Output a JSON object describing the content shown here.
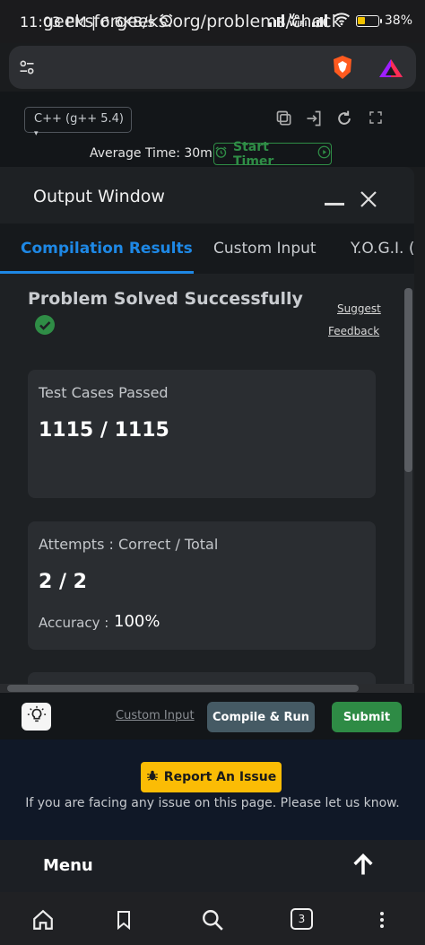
{
  "status_bar": {
    "time_speed": "11:03 PM | 6.6KB/s",
    "wifi_label": "Vo\nWiFi",
    "battery": "38%",
    "battery_level": 0.38
  },
  "browser": {
    "url": "geeksforgeeks.org/problems/check"
  },
  "editor": {
    "language": "C++ (g++ 5.4)",
    "average_time": "Average Time: 30m",
    "start_timer": "Start Timer"
  },
  "output_window": {
    "title": "Output Window",
    "tabs": [
      {
        "label": "Compilation Results",
        "active": true
      },
      {
        "label": "Custom Input",
        "active": false
      },
      {
        "label": "Y.O.G.I. (A",
        "active": false
      }
    ],
    "result_title": "Problem Solved Successfully",
    "suggest_link": "Suggest",
    "feedback_link": "Feedback",
    "test_cases": {
      "label": "Test Cases Passed",
      "value": "1115 / 1115"
    },
    "attempts": {
      "label": "Attempts : Correct / Total",
      "value": "2 / 2",
      "accuracy_label": "Accuracy :",
      "accuracy_value": "100%"
    }
  },
  "actions": {
    "custom_input": "Custom Input",
    "compile_run": "Compile & Run",
    "submit": "Submit"
  },
  "footer": {
    "report_issue": "Report An Issue",
    "note": "If you are facing any issue on this page. Please let us know.",
    "menu": "Menu"
  },
  "nav": {
    "tab_count": "3"
  },
  "colors": {
    "accent_blue": "#1e88e5",
    "gfg_green": "#2f8d46",
    "report_yellow": "#fbbc05"
  }
}
